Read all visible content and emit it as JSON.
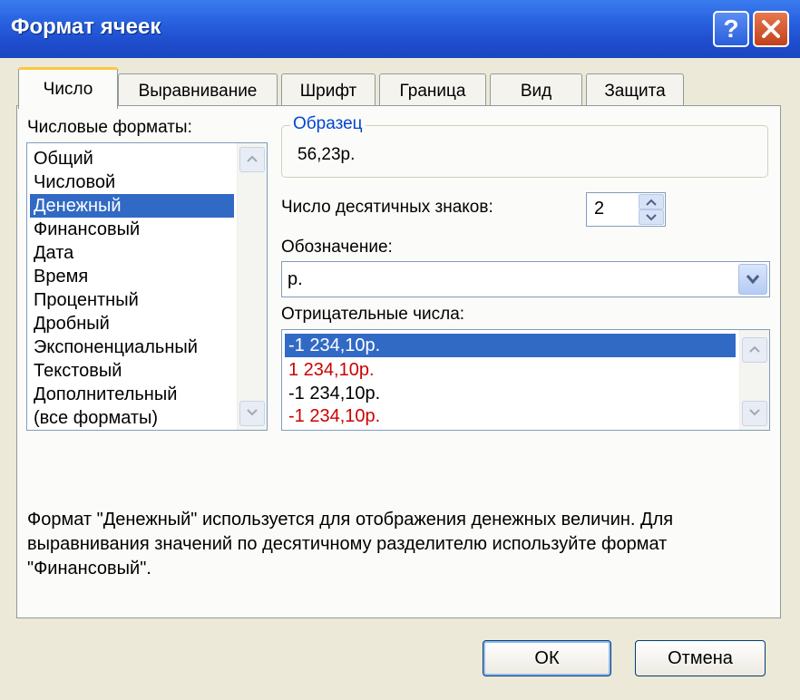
{
  "window": {
    "title": "Формат ячеек",
    "help_label": "?"
  },
  "tabs": [
    {
      "label": "Число",
      "active": true
    },
    {
      "label": "Выравнивание",
      "active": false
    },
    {
      "label": "Шрифт",
      "active": false
    },
    {
      "label": "Граница",
      "active": false
    },
    {
      "label": "Вид",
      "active": false
    },
    {
      "label": "Защита",
      "active": false
    }
  ],
  "formats": {
    "label": "Числовые форматы:",
    "items": [
      "Общий",
      "Числовой",
      "Денежный",
      "Финансовый",
      "Дата",
      "Время",
      "Процентный",
      "Дробный",
      "Экспоненциальный",
      "Текстовый",
      "Дополнительный",
      "(все форматы)"
    ],
    "selected": "Денежный"
  },
  "sample": {
    "legend": "Образец",
    "value": "56,23р."
  },
  "decimals": {
    "label": "Число десятичных знаков:",
    "value": "2"
  },
  "symbol": {
    "label": "Обозначение:",
    "value": "р."
  },
  "negative": {
    "label": "Отрицательные числа:",
    "items": [
      {
        "text": "-1 234,10р.",
        "color": "#ffffff",
        "selected": true
      },
      {
        "text": "1 234,10р.",
        "color": "#cc0000",
        "selected": false
      },
      {
        "text": "-1 234,10р.",
        "color": "#000000",
        "selected": false
      },
      {
        "text": "-1 234,10р.",
        "color": "#cc0000",
        "selected": false
      }
    ]
  },
  "description": "Формат \"Денежный\" используется для отображения денежных величин. Для выравнивания значений по десятичному разделителю используйте формат \"Финансовый\".",
  "buttons": {
    "ok": "ОК",
    "cancel": "Отмена"
  },
  "colors": {
    "selection": "#316ac5",
    "title_bar": "#2963e0",
    "negative_red": "#cc0000"
  }
}
